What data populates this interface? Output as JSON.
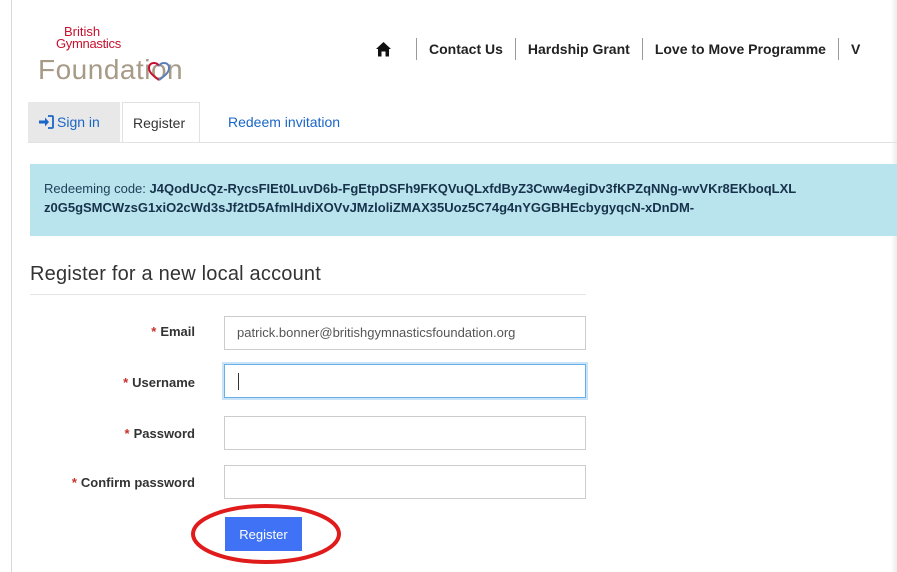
{
  "logo": {
    "line1": "British",
    "line2": "Gymnastics",
    "line3": "Foundation"
  },
  "topnav": {
    "home_icon": "home-icon",
    "items": [
      "Contact Us",
      "Hardship Grant",
      "Love to Move Programme",
      "V"
    ]
  },
  "tabs": {
    "signin": "Sign in",
    "register": "Register",
    "redeem": "Redeem invitation"
  },
  "alert": {
    "prefix": "Redeeming code: ",
    "code_line1": "J4QodUcQz-RycsFIEt0LuvD6b-FgEtpDSFh9FKQVuQLxfdByZ3Cww4egiDv3fKPZqNNg-wvVKr8EKboqLXL",
    "code_line2": "z0G5gSMCWzsG1xiO2cWd3sJf2tD5AfmlHdiXOVvJMzloliZMAX35Uoz5C74g4nYGGBHEcbygyqcN-xDnDM-"
  },
  "form": {
    "heading": "Register for a new local account",
    "required_mark": "*",
    "email_label": "Email",
    "email_value": "patrick.bonner@britishgymnasticsfoundation.org",
    "username_label": "Username",
    "username_value": "",
    "password_label": "Password",
    "confirm_label": "Confirm password",
    "register_button": "Register"
  },
  "colors": {
    "accent": "#3f72f4",
    "link": "#1a66c7",
    "alert_bg": "#b9e4ee",
    "required": "#c9302c",
    "highlight": "#e01b1b"
  }
}
